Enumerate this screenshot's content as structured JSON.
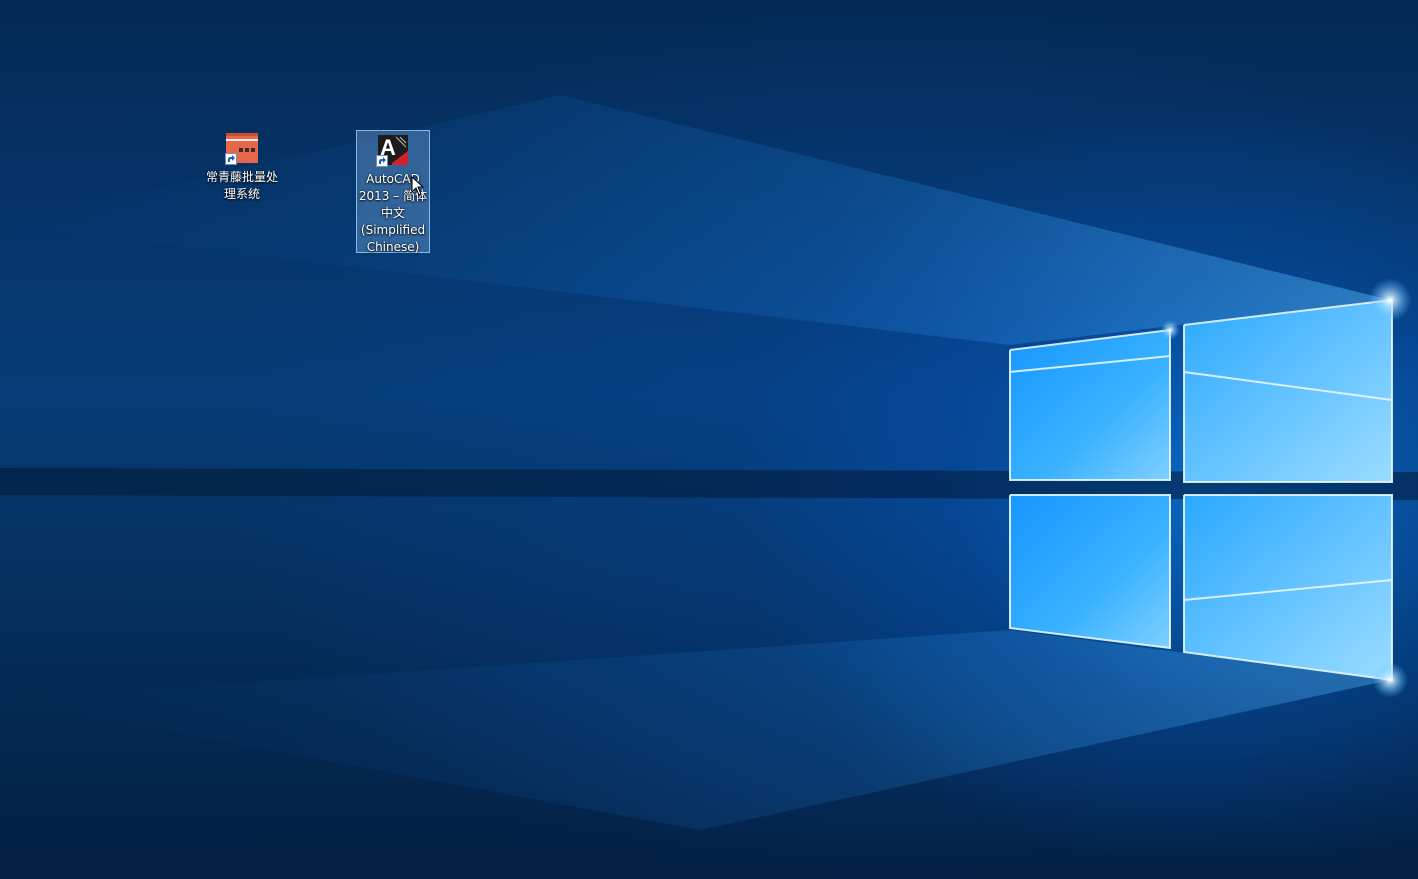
{
  "desktop": {
    "icons": [
      {
        "label": "常青藤批量处理系统",
        "icon": "batch-processing-app-icon",
        "shortcut": true,
        "selected": false
      },
      {
        "label": "AutoCAD 2013 – 简体中文 (Simplified Chinese)",
        "icon": "autocad-icon",
        "shortcut": true,
        "selected": true
      }
    ]
  },
  "wallpaper": {
    "name": "windows-10-hero-wallpaper",
    "colors": {
      "deep": "#03203f",
      "mid": "#063c78",
      "glow": "#0a78dc",
      "pane": "#2aa8ff",
      "pane_light": "#7fd0ff"
    }
  },
  "colors": {
    "selection_fill": "#78aadc",
    "selection_border": "#aad2f5",
    "label_text": "#ffffff",
    "app1_accent": "#e8674a",
    "autocad_red": "#d4202a"
  }
}
